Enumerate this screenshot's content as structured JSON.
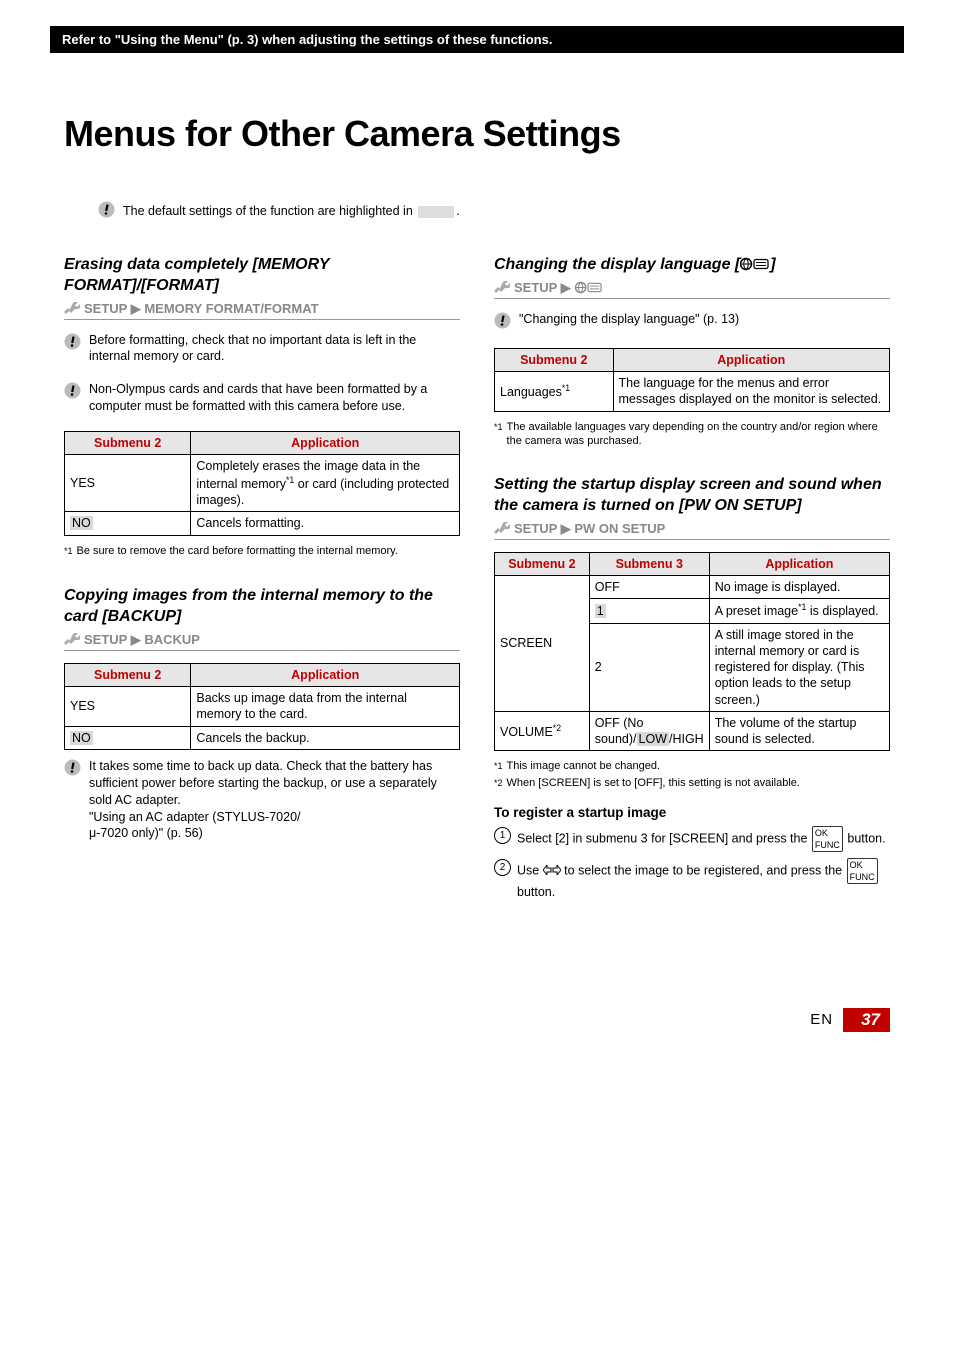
{
  "header": "Refer to \"Using the Menu\" (p. 3) when adjusting the settings of these functions.",
  "title": "Menus for Other Camera Settings",
  "intro_note": "The default settings of the function are highlighted in",
  "intro_note_tail": ".",
  "left": {
    "sec1": {
      "title": "Erasing data completely [MEMORY FORMAT]/[FORMAT]",
      "path": "SETUP ▶ MEMORY FORMAT/FORMAT",
      "note1": "Before formatting, check that no important data is left in the internal memory or card.",
      "note2": "Non-Olympus cards and cards that have been formatted by a computer must be formatted with this camera before use.",
      "th1": "Submenu 2",
      "th2": "Application",
      "r1c1": "YES",
      "r1c2_a": "Completely erases the image data in the internal memory",
      "r1c2_sup": "*1",
      "r1c2_b": " or card (including protected images).",
      "r2c1": "NO",
      "r2c2": "Cancels formatting.",
      "fn1_mark": "*1",
      "fn1": "Be sure to remove the card before formatting the internal memory."
    },
    "sec2": {
      "title": "Copying images from the internal memory to the card [BACKUP]",
      "path": "SETUP ▶ BACKUP",
      "th1": "Submenu 2",
      "th2": "Application",
      "r1c1": "YES",
      "r1c2": "Backs up image data from the internal memory to the card.",
      "r2c1": "NO",
      "r2c2": "Cancels the backup.",
      "note": "It takes some time to back up data. Check that the battery has sufficient power before starting the backup, or use a separately sold AC adapter.\n\"Using an AC adapter (STYLUS-7020/\nμ-7020 only)\" (p. 56)"
    }
  },
  "right": {
    "sec1": {
      "title_a": "Changing the display language [",
      "title_b": "]",
      "path": "SETUP ▶",
      "note": "\"Changing the display language\" (p. 13)",
      "th1": "Submenu 2",
      "th2": "Application",
      "r1c1_a": "Languages",
      "r1c1_sup": "*1",
      "r1c2": "The language for the menus and error messages displayed on the monitor is selected.",
      "fn1_mark": "*1",
      "fn1": "The available languages vary depending on the country and/or region where the camera was purchased."
    },
    "sec2": {
      "title": "Setting the startup display screen and sound when the camera is turned on [PW ON SETUP]",
      "path": "SETUP ▶ PW ON SETUP",
      "th1": "Submenu 2",
      "th2": "Submenu 3",
      "th3": "Application",
      "screen_label": "SCREEN",
      "screen_r1_s3": "OFF",
      "screen_r1_app": "No image is displayed.",
      "screen_r2_s3": "1",
      "screen_r2_app_a": "A preset image",
      "screen_r2_app_sup": "*1",
      "screen_r2_app_b": " is displayed.",
      "screen_r3_s3": "2",
      "screen_r3_app": "A still image stored in the internal memory or card is registered for display. (This option leads to the setup screen.)",
      "vol_label_a": "VOLUME",
      "vol_label_sup": "*2",
      "vol_s3_a": "OFF (No sound)/",
      "vol_s3_hl": "LOW",
      "vol_s3_b": "/HIGH",
      "vol_app": "The volume of the startup sound is selected.",
      "fn1_mark": "*1",
      "fn1": "This image cannot be changed.",
      "fn2_mark": "*2",
      "fn2": "When [SCREEN] is set to [OFF], this setting is not available.",
      "subhead": "To register a startup image",
      "step1_a": "Select [2] in submenu 3 for [SCREEN] and press the ",
      "step1_b": " button.",
      "step2_a": "Use ",
      "step2_b": " to select the image to be registered, and press the ",
      "step2_c": " button."
    }
  },
  "footer": {
    "en": "EN",
    "page": "37"
  }
}
